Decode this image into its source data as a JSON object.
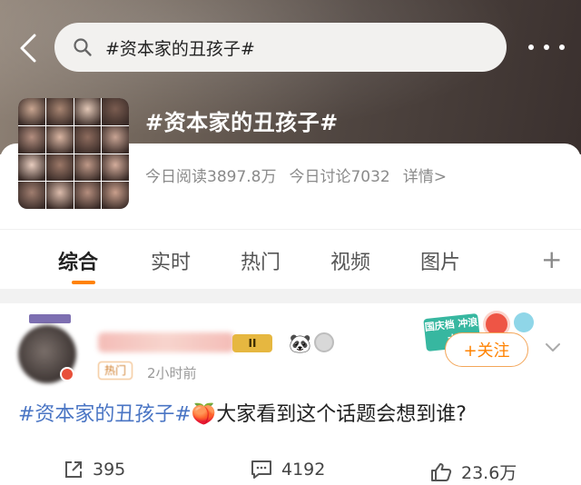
{
  "search": {
    "query": "#资本家的丑孩子#"
  },
  "topic": {
    "title": "#资本家的丑孩子#",
    "reads": "今日阅读3897.8万",
    "discussions": "今日讨论7032",
    "detail_link": "详情>"
  },
  "tabs": [
    {
      "label": "综合",
      "active": true
    },
    {
      "label": "实时",
      "active": false
    },
    {
      "label": "热门",
      "active": false
    },
    {
      "label": "视频",
      "active": false
    },
    {
      "label": "图片",
      "active": false
    }
  ],
  "tab_add": "+",
  "post": {
    "level": "II",
    "tag": "热门",
    "time": "2小时前",
    "follow_label": "+关注",
    "promo_text": "国庆档 冲浪大",
    "content_hashtag": "#资本家的丑孩子#",
    "content_emoji": "🍑",
    "content_text": "大家看到这个话题会想到谁?",
    "reposts": "395",
    "comments": "4192",
    "likes": "23.6万"
  },
  "colors": {
    "accent": "#ff8200",
    "hashtag": "#4a75c4"
  },
  "avatar_colors": [
    "#c9a691",
    "#a88572",
    "#e2c7b6",
    "#7a5c50",
    "#b48f80",
    "#d9b5a2",
    "#8e6c5e",
    "#c8a494",
    "#e8cdbf",
    "#9c7868",
    "#bf9988",
    "#d4ad9c",
    "#a07e70",
    "#dcbcac",
    "#b58e7e",
    "#c99f8c"
  ]
}
